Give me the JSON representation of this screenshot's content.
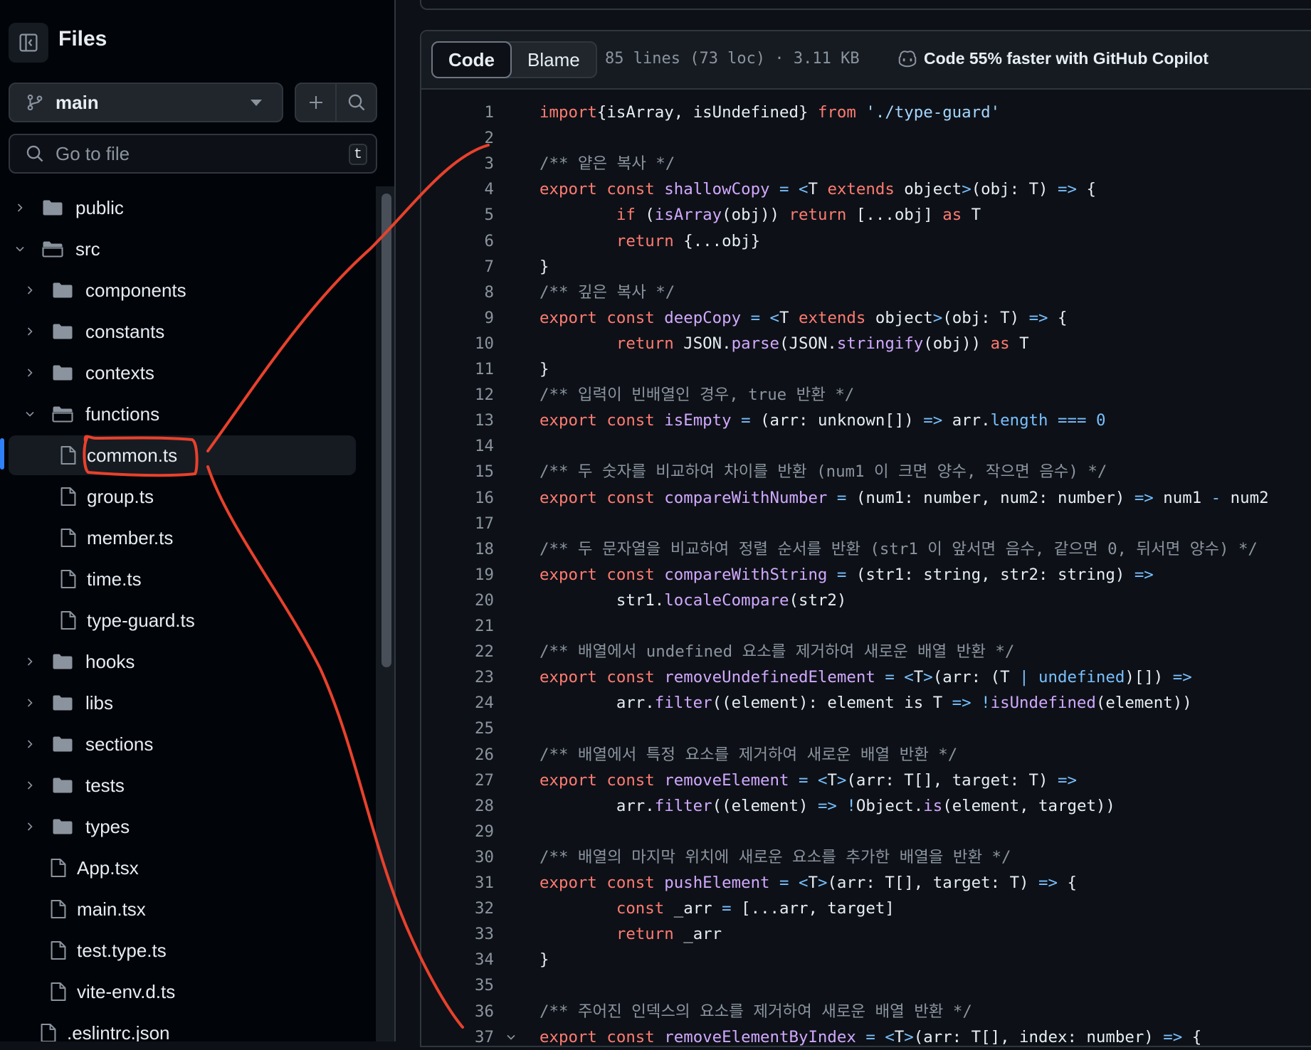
{
  "sidebar": {
    "title": "Files",
    "branch": "main",
    "search_placeholder": "Go to file",
    "search_shortcut": "t",
    "tree": [
      {
        "label": "public",
        "type": "folder",
        "depth": 0,
        "expanded": false
      },
      {
        "label": "src",
        "type": "folder",
        "depth": 0,
        "expanded": true
      },
      {
        "label": "components",
        "type": "folder",
        "depth": 1,
        "expanded": false
      },
      {
        "label": "constants",
        "type": "folder",
        "depth": 1,
        "expanded": false
      },
      {
        "label": "contexts",
        "type": "folder",
        "depth": 1,
        "expanded": false
      },
      {
        "label": "functions",
        "type": "folder",
        "depth": 1,
        "expanded": true
      },
      {
        "label": "common.ts",
        "type": "file",
        "depth": 2,
        "selected": true
      },
      {
        "label": "group.ts",
        "type": "file",
        "depth": 2
      },
      {
        "label": "member.ts",
        "type": "file",
        "depth": 2
      },
      {
        "label": "time.ts",
        "type": "file",
        "depth": 2
      },
      {
        "label": "type-guard.ts",
        "type": "file",
        "depth": 2
      },
      {
        "label": "hooks",
        "type": "folder",
        "depth": 1,
        "expanded": false
      },
      {
        "label": "libs",
        "type": "folder",
        "depth": 1,
        "expanded": false
      },
      {
        "label": "sections",
        "type": "folder",
        "depth": 1,
        "expanded": false
      },
      {
        "label": "tests",
        "type": "folder",
        "depth": 1,
        "expanded": false
      },
      {
        "label": "types",
        "type": "folder",
        "depth": 1,
        "expanded": false
      },
      {
        "label": "App.tsx",
        "type": "file",
        "depth": 1
      },
      {
        "label": "main.tsx",
        "type": "file",
        "depth": 1
      },
      {
        "label": "test.type.ts",
        "type": "file",
        "depth": 1
      },
      {
        "label": "vite-env.d.ts",
        "type": "file",
        "depth": 1
      },
      {
        "label": ".eslintrc.json",
        "type": "file",
        "depth": 0
      }
    ]
  },
  "toolbar": {
    "code_tab": "Code",
    "blame_tab": "Blame",
    "stats": "85 lines (73 loc) · 3.11 KB",
    "copilot": "Code 55% faster with GitHub Copilot"
  },
  "code": {
    "lines": [
      {
        "n": "1",
        "tokens": [
          [
            "k",
            "import"
          ],
          [
            "",
            "{isArray, isUndefined} "
          ],
          [
            "k",
            "from"
          ],
          [
            "",
            " "
          ],
          [
            "s",
            "'./type-guard'"
          ]
        ]
      },
      {
        "n": "2",
        "tokens": []
      },
      {
        "n": "3",
        "tokens": [
          [
            "c",
            "/** 얕은 복사 */"
          ]
        ]
      },
      {
        "n": "4",
        "tokens": [
          [
            "k",
            "export const"
          ],
          [
            "",
            " "
          ],
          [
            "f",
            "shallowCopy"
          ],
          [
            "",
            " "
          ],
          [
            "n",
            "="
          ],
          [
            "",
            " "
          ],
          [
            "n",
            "<"
          ],
          [
            "",
            "T "
          ],
          [
            "k",
            "extends"
          ],
          [
            "",
            " object"
          ],
          [
            "n",
            ">"
          ],
          [
            "",
            "(obj: T) "
          ],
          [
            "n",
            "=>"
          ],
          [
            "",
            " {"
          ]
        ]
      },
      {
        "n": "5",
        "tokens": [
          [
            "",
            "        "
          ],
          [
            "k",
            "if"
          ],
          [
            "",
            " ("
          ],
          [
            "f",
            "isArray"
          ],
          [
            "",
            "(obj)) "
          ],
          [
            "k",
            "return"
          ],
          [
            "",
            " [...obj] "
          ],
          [
            "k",
            "as"
          ],
          [
            "",
            " T"
          ]
        ]
      },
      {
        "n": "6",
        "tokens": [
          [
            "",
            "        "
          ],
          [
            "k",
            "return"
          ],
          [
            "",
            " {...obj}"
          ]
        ]
      },
      {
        "n": "7",
        "tokens": [
          [
            "",
            "}"
          ]
        ]
      },
      {
        "n": "8",
        "tokens": [
          [
            "c",
            "/** 깊은 복사 */"
          ]
        ]
      },
      {
        "n": "9",
        "tokens": [
          [
            "k",
            "export const"
          ],
          [
            "",
            " "
          ],
          [
            "f",
            "deepCopy"
          ],
          [
            "",
            " "
          ],
          [
            "n",
            "="
          ],
          [
            "",
            " "
          ],
          [
            "n",
            "<"
          ],
          [
            "",
            "T "
          ],
          [
            "k",
            "extends"
          ],
          [
            "",
            " object"
          ],
          [
            "n",
            ">"
          ],
          [
            "",
            "(obj: T) "
          ],
          [
            "n",
            "=>"
          ],
          [
            "",
            " {"
          ]
        ]
      },
      {
        "n": "10",
        "tokens": [
          [
            "",
            "        "
          ],
          [
            "k",
            "return"
          ],
          [
            "",
            " JSON."
          ],
          [
            "f",
            "parse"
          ],
          [
            "",
            "(JSON."
          ],
          [
            "f",
            "stringify"
          ],
          [
            "",
            "(obj)) "
          ],
          [
            "k",
            "as"
          ],
          [
            "",
            " T"
          ]
        ]
      },
      {
        "n": "11",
        "tokens": [
          [
            "",
            "}"
          ]
        ]
      },
      {
        "n": "12",
        "tokens": [
          [
            "c",
            "/** 입력이 빈배열인 경우, true 반환 */"
          ]
        ]
      },
      {
        "n": "13",
        "tokens": [
          [
            "k",
            "export const"
          ],
          [
            "",
            " "
          ],
          [
            "f",
            "isEmpty"
          ],
          [
            "",
            " "
          ],
          [
            "n",
            "="
          ],
          [
            "",
            " (arr: unknown[]) "
          ],
          [
            "n",
            "=>"
          ],
          [
            "",
            " arr."
          ],
          [
            "n",
            "length"
          ],
          [
            "",
            " "
          ],
          [
            "n",
            "==="
          ],
          [
            "",
            " "
          ],
          [
            "n",
            "0"
          ]
        ]
      },
      {
        "n": "14",
        "tokens": []
      },
      {
        "n": "15",
        "tokens": [
          [
            "c",
            "/** 두 숫자를 비교하여 차이를 반환 (num1 이 크면 양수, 작으면 음수) */"
          ]
        ]
      },
      {
        "n": "16",
        "tokens": [
          [
            "k",
            "export const"
          ],
          [
            "",
            " "
          ],
          [
            "f",
            "compareWithNumber"
          ],
          [
            "",
            " "
          ],
          [
            "n",
            "="
          ],
          [
            "",
            " (num1: number, num2: number) "
          ],
          [
            "n",
            "=>"
          ],
          [
            "",
            " num1 "
          ],
          [
            "n",
            "-"
          ],
          [
            "",
            " num2"
          ]
        ]
      },
      {
        "n": "17",
        "tokens": []
      },
      {
        "n": "18",
        "tokens": [
          [
            "c",
            "/** 두 문자열을 비교하여 정렬 순서를 반환 (str1 이 앞서면 음수, 같으면 0, 뒤서면 양수) */"
          ]
        ]
      },
      {
        "n": "19",
        "tokens": [
          [
            "k",
            "export const"
          ],
          [
            "",
            " "
          ],
          [
            "f",
            "compareWithString"
          ],
          [
            "",
            " "
          ],
          [
            "n",
            "="
          ],
          [
            "",
            " (str1: string, str2: string) "
          ],
          [
            "n",
            "=>"
          ]
        ]
      },
      {
        "n": "20",
        "tokens": [
          [
            "",
            "        str1."
          ],
          [
            "f",
            "localeCompare"
          ],
          [
            "",
            "(str2)"
          ]
        ]
      },
      {
        "n": "21",
        "tokens": []
      },
      {
        "n": "22",
        "tokens": [
          [
            "c",
            "/** 배열에서 undefined 요소를 제거하여 새로운 배열 반환 */"
          ]
        ]
      },
      {
        "n": "23",
        "tokens": [
          [
            "k",
            "export const"
          ],
          [
            "",
            " "
          ],
          [
            "f",
            "removeUndefinedElement"
          ],
          [
            "",
            " "
          ],
          [
            "n",
            "="
          ],
          [
            "",
            " "
          ],
          [
            "n",
            "<"
          ],
          [
            "",
            "T"
          ],
          [
            "n",
            ">"
          ],
          [
            "",
            "(arr: (T "
          ],
          [
            "n",
            "|"
          ],
          [
            "",
            " "
          ],
          [
            "n",
            "undefined"
          ],
          [
            "",
            ")[]) "
          ],
          [
            "n",
            "=>"
          ]
        ]
      },
      {
        "n": "24",
        "tokens": [
          [
            "",
            "        arr."
          ],
          [
            "f",
            "filter"
          ],
          [
            "",
            "((element): element is T "
          ],
          [
            "n",
            "=>"
          ],
          [
            "",
            " "
          ],
          [
            "n",
            "!"
          ],
          [
            "f",
            "isUndefined"
          ],
          [
            "",
            "(element))"
          ]
        ]
      },
      {
        "n": "25",
        "tokens": []
      },
      {
        "n": "26",
        "tokens": [
          [
            "c",
            "/** 배열에서 특정 요소를 제거하여 새로운 배열 반환 */"
          ]
        ]
      },
      {
        "n": "27",
        "tokens": [
          [
            "k",
            "export const"
          ],
          [
            "",
            " "
          ],
          [
            "f",
            "removeElement"
          ],
          [
            "",
            " "
          ],
          [
            "n",
            "="
          ],
          [
            "",
            " "
          ],
          [
            "n",
            "<"
          ],
          [
            "",
            "T"
          ],
          [
            "n",
            ">"
          ],
          [
            "",
            "(arr: T[], target: T) "
          ],
          [
            "n",
            "=>"
          ]
        ]
      },
      {
        "n": "28",
        "tokens": [
          [
            "",
            "        arr."
          ],
          [
            "f",
            "filter"
          ],
          [
            "",
            "((element) "
          ],
          [
            "n",
            "=>"
          ],
          [
            "",
            " "
          ],
          [
            "n",
            "!"
          ],
          [
            "",
            "Object."
          ],
          [
            "f",
            "is"
          ],
          [
            "",
            "(element, target))"
          ]
        ]
      },
      {
        "n": "29",
        "tokens": []
      },
      {
        "n": "30",
        "tokens": [
          [
            "c",
            "/** 배열의 마지막 위치에 새로운 요소를 추가한 배열을 반환 */"
          ]
        ]
      },
      {
        "n": "31",
        "tokens": [
          [
            "k",
            "export const"
          ],
          [
            "",
            " "
          ],
          [
            "f",
            "pushElement"
          ],
          [
            "",
            " "
          ],
          [
            "n",
            "="
          ],
          [
            "",
            " "
          ],
          [
            "n",
            "<"
          ],
          [
            "",
            "T"
          ],
          [
            "n",
            ">"
          ],
          [
            "",
            "(arr: T[], target: T) "
          ],
          [
            "n",
            "=>"
          ],
          [
            "",
            " {"
          ]
        ]
      },
      {
        "n": "32",
        "tokens": [
          [
            "",
            "        "
          ],
          [
            "k",
            "const"
          ],
          [
            "",
            " _arr "
          ],
          [
            "n",
            "="
          ],
          [
            "",
            " [...arr, target]"
          ]
        ]
      },
      {
        "n": "33",
        "tokens": [
          [
            "",
            "        "
          ],
          [
            "k",
            "return"
          ],
          [
            "",
            " _arr"
          ]
        ]
      },
      {
        "n": "34",
        "tokens": [
          [
            "",
            "}"
          ]
        ]
      },
      {
        "n": "35",
        "tokens": []
      },
      {
        "n": "36",
        "tokens": [
          [
            "c",
            "/** 주어진 인덱스의 요소를 제거하여 새로운 배열 반환 */"
          ]
        ]
      },
      {
        "n": "37",
        "tokens": [
          [
            "k",
            "export const"
          ],
          [
            "",
            " "
          ],
          [
            "f",
            "removeElementByIndex"
          ],
          [
            "",
            " "
          ],
          [
            "n",
            "="
          ],
          [
            "",
            " "
          ],
          [
            "n",
            "<"
          ],
          [
            "",
            "T"
          ],
          [
            "n",
            ">"
          ],
          [
            "",
            "(arr: T[], index: number) "
          ],
          [
            "n",
            "=>"
          ],
          [
            "",
            " {"
          ]
        ],
        "fold": true
      }
    ]
  },
  "colors": {
    "keyword": "#ff7b72",
    "function": "#d2a8ff",
    "comment": "#8b949e",
    "string": "#a5d6ff",
    "constant": "#79c0ff",
    "annotation": "#e8412c",
    "accent": "#2f81f7"
  }
}
